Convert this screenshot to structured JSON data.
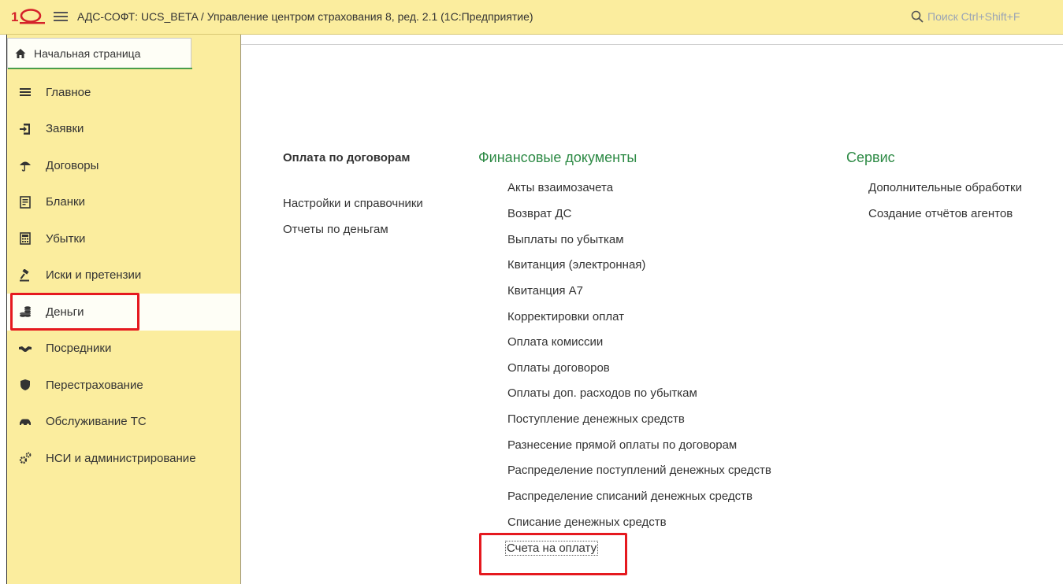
{
  "window": {
    "title": "АДС-СОФТ: UCS_BETA / Управление центром страхования 8, ред. 2.1  (1С:Предприятие)",
    "logo_text": "1С",
    "search_placeholder": "Поиск Ctrl+Shift+F"
  },
  "sidebar": {
    "home_tab": "Начальная страница",
    "items": [
      {
        "label": "Главное",
        "icon": "menu-lines-icon"
      },
      {
        "label": "Заявки",
        "icon": "sign-in-icon"
      },
      {
        "label": "Договоры",
        "icon": "umbrella-icon"
      },
      {
        "label": "Бланки",
        "icon": "form-sheet-icon"
      },
      {
        "label": "Убытки",
        "icon": "calculator-icon"
      },
      {
        "label": "Иски и претензии",
        "icon": "gavel-icon"
      },
      {
        "label": "Деньги",
        "icon": "coins-icon",
        "active": true
      },
      {
        "label": "Посредники",
        "icon": "handshake-icon"
      },
      {
        "label": "Перестрахование",
        "icon": "shield-icon"
      },
      {
        "label": "Обслуживание ТС",
        "icon": "car-icon"
      },
      {
        "label": "НСИ и администрирование",
        "icon": "gears-icon"
      }
    ]
  },
  "content": {
    "col1": {
      "heading": "Оплата по договорам",
      "links": [
        "Настройки и справочники",
        "Отчеты по деньгам"
      ]
    },
    "col2": {
      "heading": "Финансовые документы",
      "links": [
        "Акты взаимозачета",
        "Возврат ДС",
        "Выплаты по убыткам",
        "Квитанция (электронная)",
        "Квитанция А7",
        "Корректировки оплат",
        "Оплата комиссии",
        "Оплаты договоров",
        "Оплаты доп. расходов по убыткам",
        "Поступление денежных средств",
        "Разнесение прямой оплаты по договорам",
        "Распределение поступлений денежных средств",
        "Распределение списаний денежных средств",
        "Списание денежных средств",
        "Счета на оплату"
      ]
    },
    "col3": {
      "heading": "Сервис",
      "links": [
        "Дополнительные обработки",
        "Создание отчётов агентов"
      ]
    }
  },
  "colors": {
    "panel_yellow": "#fbed9e",
    "heading_green": "#2d8a45",
    "highlight_red": "#e5191f"
  }
}
